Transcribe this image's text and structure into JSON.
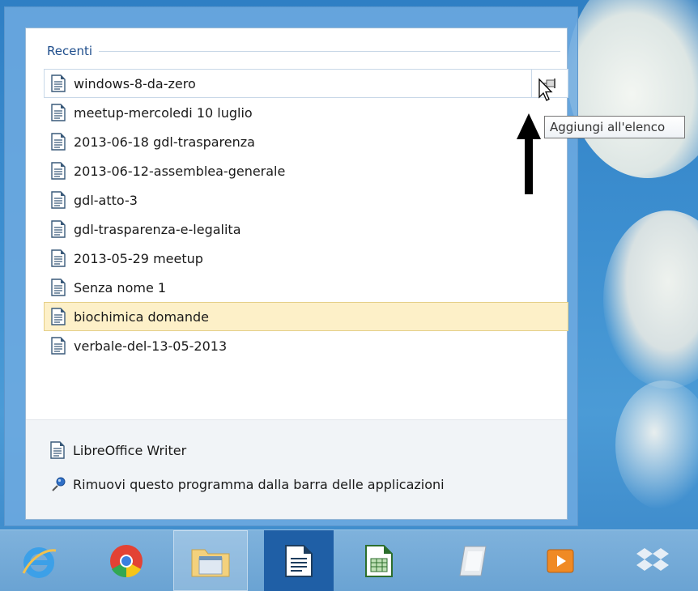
{
  "jumplist": {
    "section_title": "Recenti",
    "recent_items": [
      {
        "label": "windows-8-da-zero",
        "state": "hover"
      },
      {
        "label": "meetup-mercoledi 10 luglio",
        "state": "normal"
      },
      {
        "label": "2013-06-18 gdl-trasparenza",
        "state": "normal"
      },
      {
        "label": "2013-06-12-assemblea-generale",
        "state": "normal"
      },
      {
        "label": "gdl-atto-3",
        "state": "normal"
      },
      {
        "label": "gdl-trasparenza-e-legalita",
        "state": "normal"
      },
      {
        "label": "2013-05-29 meetup",
        "state": "normal"
      },
      {
        "label": "Senza nome 1",
        "state": "normal"
      },
      {
        "label": "biochimica domande",
        "state": "selected"
      },
      {
        "label": "verbale-del-13-05-2013",
        "state": "normal"
      }
    ],
    "tasks": [
      {
        "label": "LibreOffice Writer",
        "icon": "writer-doc-icon"
      },
      {
        "label": "Rimuovi questo programma dalla barra delle applicazioni",
        "icon": "unpin-icon"
      }
    ]
  },
  "tooltip": {
    "text": "Aggiungi all'elenco"
  },
  "taskbar": {
    "apps": [
      {
        "name": "internet-explorer",
        "icon": "ie-icon"
      },
      {
        "name": "chrome",
        "icon": "chrome-icon"
      },
      {
        "name": "file-explorer",
        "icon": "folder-icon"
      },
      {
        "name": "libreoffice-writer",
        "icon": "writer-icon"
      },
      {
        "name": "libreoffice-calc",
        "icon": "calc-icon"
      },
      {
        "name": "notes",
        "icon": "notes-icon"
      },
      {
        "name": "media-player",
        "icon": "media-icon"
      },
      {
        "name": "dropbox",
        "icon": "dropbox-icon"
      }
    ]
  },
  "colors": {
    "accent": "#2f7fc4",
    "selected_bg": "#fdf0c8",
    "selected_border": "#e5cf88",
    "section_title": "#1f4e8c"
  }
}
